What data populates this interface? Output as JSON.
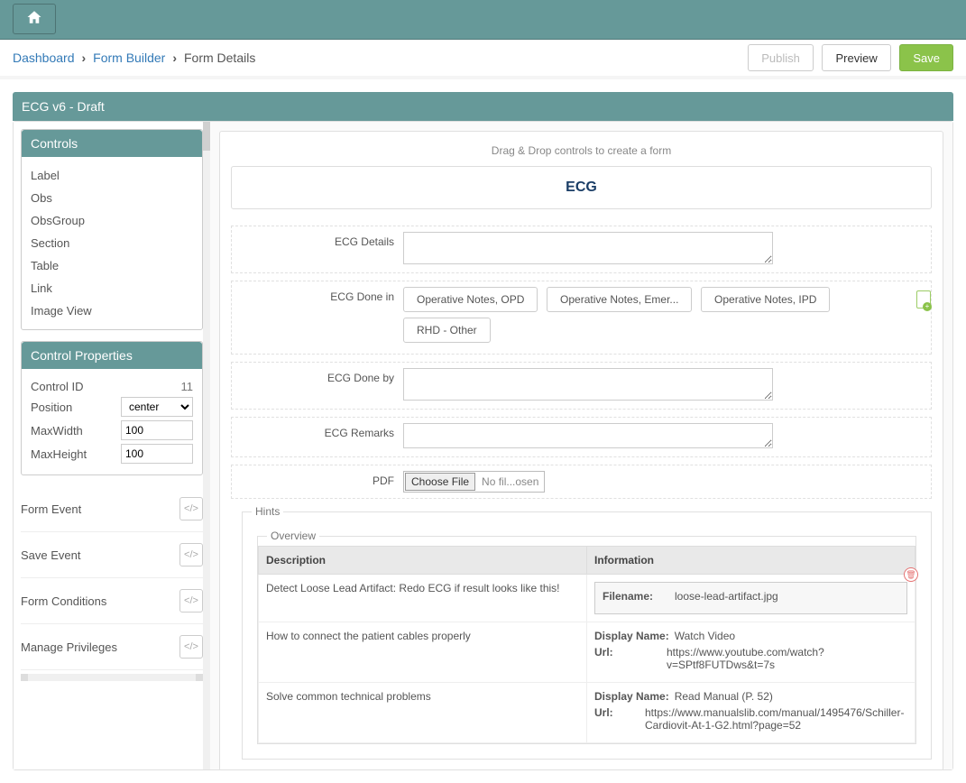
{
  "topbar": {
    "home_icon": "home"
  },
  "breadcrumb": {
    "items": [
      "Dashboard",
      "Form Builder",
      "Form Details"
    ]
  },
  "actions": {
    "publish": "Publish",
    "preview": "Preview",
    "save": "Save"
  },
  "panel_title": "ECG v6 - Draft",
  "controls_panel": {
    "title": "Controls",
    "items": [
      "Label",
      "Obs",
      "ObsGroup",
      "Section",
      "Table",
      "Link",
      "Image View"
    ]
  },
  "props_panel": {
    "title": "Control Properties",
    "control_id_label": "Control ID",
    "control_id_value": "11",
    "position_label": "Position",
    "position_value": "center",
    "maxwidth_label": "MaxWidth",
    "maxwidth_value": "100",
    "maxheight_label": "MaxHeight",
    "maxheight_value": "100"
  },
  "events": {
    "form_event": "Form Event",
    "save_event": "Save Event",
    "form_conditions": "Form Conditions",
    "manage_privileges": "Manage Privileges"
  },
  "canvas": {
    "dd_hint": "Drag & Drop controls to create a form",
    "form_title": "ECG",
    "fields": {
      "ecg_details": "ECG Details",
      "ecg_done_in": "ECG Done in",
      "ecg_done_in_options": [
        "Operative Notes, OPD",
        "Operative Notes, Emer...",
        "Operative Notes, IPD",
        "RHD - Other"
      ],
      "ecg_done_by": "ECG Done by",
      "ecg_remarks": "ECG Remarks",
      "pdf": "PDF",
      "choose_file": "Choose File",
      "no_file": "No fil...osen"
    },
    "hints": {
      "title": "Hints",
      "overview": "Overview",
      "cols": {
        "description": "Description",
        "information": "Information"
      },
      "rows": [
        {
          "desc": "Detect Loose Lead Artifact: Redo ECG if result looks like this!",
          "info_type": "file",
          "filename_label": "Filename:",
          "filename": "loose-lead-artifact.jpg"
        },
        {
          "desc": "How to connect the patient cables properly",
          "info_type": "link",
          "display_name_label": "Display Name:",
          "display_name": "Watch Video",
          "url_label": "Url:",
          "url": "https://www.youtube.com/watch?v=SPtf8FUTDws&t=7s"
        },
        {
          "desc": "Solve common technical problems",
          "info_type": "link",
          "display_name_label": "Display Name:",
          "display_name": "Read Manual (P. 52)",
          "url_label": "Url:",
          "url": "https://www.manualslib.com/manual/1495476/Schiller-Cardiovit-At-1-G2.html?page=52"
        }
      ]
    }
  }
}
